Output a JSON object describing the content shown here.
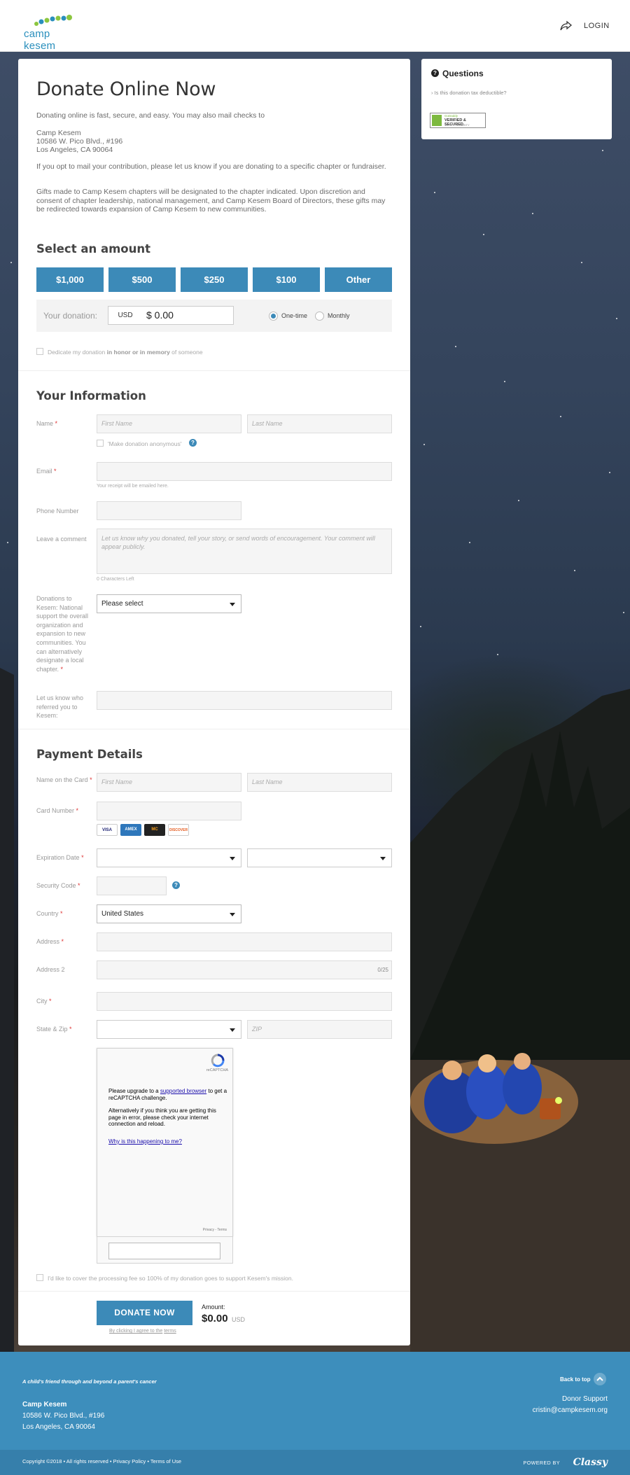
{
  "header": {
    "logo_text": "camp kesem",
    "login_label": "LOGIN"
  },
  "donate": {
    "title": "Donate Online Now",
    "intro": "Donating online is fast, secure, and easy. You may also mail checks to",
    "mail_name": "Camp Kesem",
    "mail_street": "10586 W. Pico Blvd., #196",
    "mail_city": "Los Angeles, CA 90064",
    "mail_note": "If you opt to mail your contribution, please let us know if you are donating to a specific chapter or fundraiser.",
    "gifts_note": "Gifts made to Camp Kesem chapters will be designated to the chapter indicated. Upon discretion and consent of chapter leadership, national management, and Camp Kesem Board of Directors, these gifts may be redirected towards expansion of Camp Kesem to new communities."
  },
  "amount": {
    "section_title": "Select an amount",
    "buttons": [
      "$1,000",
      "$500",
      "$250",
      "$100",
      "Other"
    ],
    "donation_label": "Your donation:",
    "currency": "USD",
    "value": "$ 0.00",
    "frequency": [
      "One-time",
      "Monthly"
    ],
    "frequency_selected": "One-time",
    "dedicate_pre": "Dedicate my donation",
    "dedicate_bold": "in honor or in memory",
    "dedicate_post": "of someone"
  },
  "info": {
    "section_title": "Your Information",
    "name_label": "Name",
    "first_name_placeholder": "First Name",
    "last_name_placeholder": "Last Name",
    "anonymous_label": "Make donation anonymous",
    "email_label": "Email",
    "email_hint": "Your receipt will be emailed here.",
    "phone_label": "Phone Number",
    "comment_label": "Leave a comment",
    "comment_placeholder": "Let us know why you donated, tell your story, or send words of encouragement. Your comment will appear publicly.",
    "chars_left": "0 Characters Left",
    "designation_label": "Donations to Kesem: National support the overall organization and expansion to new communities. You can alternatively designate a local chapter.",
    "designation_value": "Please select",
    "referral_label": "Let us know who referred you to Kesem:"
  },
  "payment": {
    "section_title": "Payment Details",
    "card_name_label": "Name on the Card",
    "first_name_placeholder": "First Name",
    "last_name_placeholder": "Last Name",
    "card_number_label": "Card Number",
    "cards": [
      "VISA",
      "AMEX",
      "MC",
      "DISCOVER"
    ],
    "expiration_label": "Expiration Date",
    "security_label": "Security Code",
    "country_label": "Country",
    "country_value": "United States",
    "address_label": "Address",
    "address2_label": "Address 2",
    "address2_count": "0/25",
    "city_label": "City",
    "state_zip_label": "State & Zip",
    "zip_placeholder": "ZIP"
  },
  "recaptcha": {
    "brand": "reCAPTCHA",
    "line1_pre": "Please upgrade to a",
    "line1_link": "supported browser",
    "line1_post": "to get a reCAPTCHA challenge.",
    "line2": "Alternatively if you think you are getting this page in error, please check your internet connection and reload.",
    "why_link": "Why is this happening to me?",
    "privacy": "Privacy - Terms"
  },
  "cover_fee_label": "I'd like to cover the processing fee so 100% of my donation goes to support Kesem's mission.",
  "submit": {
    "button_label": "DONATE NOW",
    "amount_label": "Amount:",
    "amount_value": "$0.00",
    "amount_currency": "USD",
    "terms_pre": "By clicking I agree to the",
    "terms_link": "terms"
  },
  "questions": {
    "title": "Questions",
    "items": [
      "Is this donation tax deductible?"
    ],
    "badge_line1": "GoDaddy",
    "badge_line2": "VERIFIED & SECURED",
    "badge_line3": "VERIFY SECURITY"
  },
  "footer": {
    "tagline": "A child's friend through and beyond a parent's cancer",
    "org_name": "Camp Kesem",
    "street": "10586 W. Pico Blvd., #196",
    "city": "Los Angeles, CA 90064",
    "back_to_top": "Back to top",
    "support_label": "Donor Support",
    "support_email": "cristin@campkesem.org",
    "copyright": "Copyright ©2018 • All rights reserved • Privacy Policy • Terms of Use",
    "powered_by": "POWERED BY",
    "powered_brand": "Classy"
  },
  "colors": {
    "accent": "#3c8ab8",
    "footer": "#3d8ebc",
    "required": "#dd3333"
  }
}
